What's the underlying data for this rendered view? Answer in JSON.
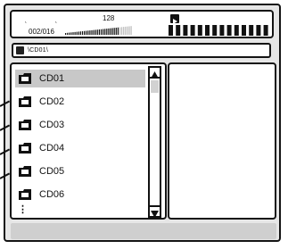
{
  "status": {
    "tick_a": "˛",
    "tick_b": "˛",
    "track_count": "128",
    "track_position": "002/016",
    "level_meter_fraction": 0.8
  },
  "path_bar": {
    "path": "\\CD01\\"
  },
  "file_list": {
    "items": [
      {
        "label": "CD01",
        "icon": "folder-icon",
        "selected": true
      },
      {
        "label": "CD02",
        "icon": "folder-icon",
        "selected": false
      },
      {
        "label": "CD03",
        "icon": "folder-icon",
        "selected": false
      },
      {
        "label": "CD04",
        "icon": "folder-icon",
        "selected": false
      },
      {
        "label": "CD05",
        "icon": "folder-icon",
        "selected": false
      },
      {
        "label": "CD06",
        "icon": "folder-icon",
        "selected": false
      }
    ],
    "more_indicator": "⋮"
  },
  "scrollbar": {
    "up_icon": "triangle-up-icon",
    "down_icon": "triangle-down-icon"
  },
  "colors": {
    "frame": "#e6e6e6",
    "selection": "#c8c8c8",
    "outline": "#141414"
  }
}
